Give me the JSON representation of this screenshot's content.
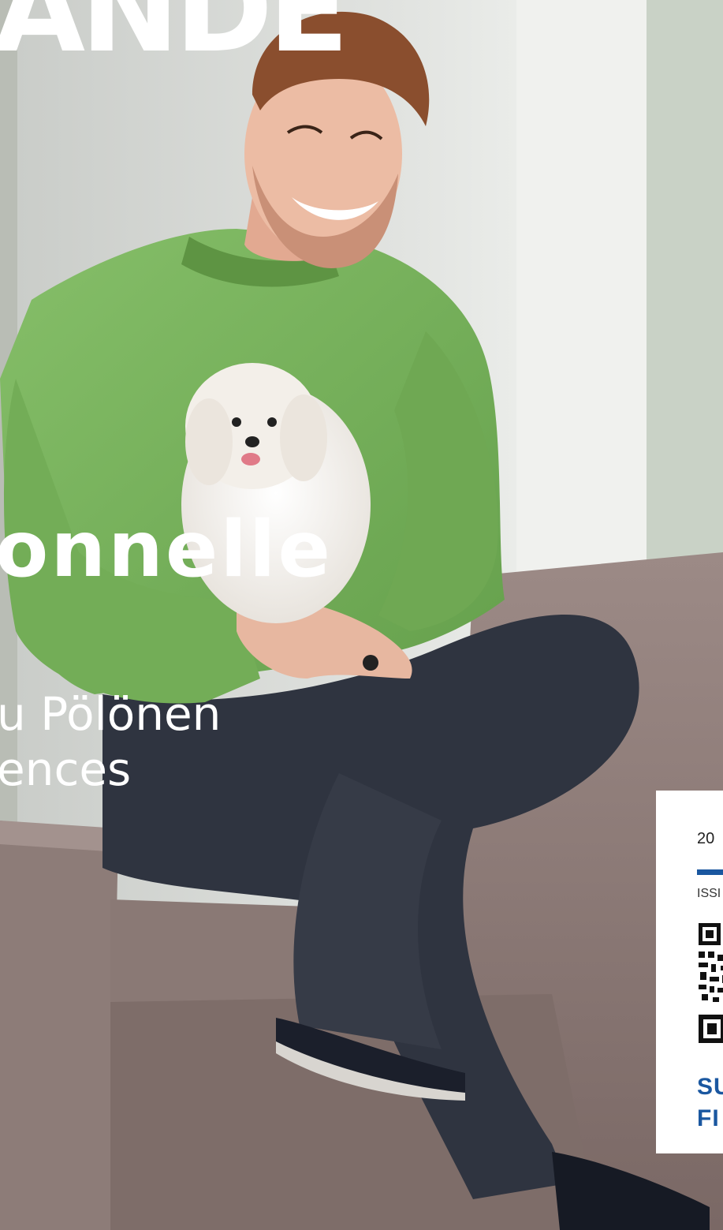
{
  "cover": {
    "masthead": "ANDE",
    "headline": "onnelle",
    "subline": [
      "u Pölönen",
      "ences"
    ]
  },
  "info_box": {
    "issue_year": "20",
    "issn": "ISSI",
    "brand": [
      "SU",
      "FI"
    ]
  },
  "colors": {
    "accent_blue": "#1a57a0",
    "sweater_green": "#79b25d",
    "jeans": "#2f3440",
    "wall": "#dcdfdc",
    "stone": "#8f7b77"
  },
  "icons": {
    "qr": "qr-code-icon"
  }
}
